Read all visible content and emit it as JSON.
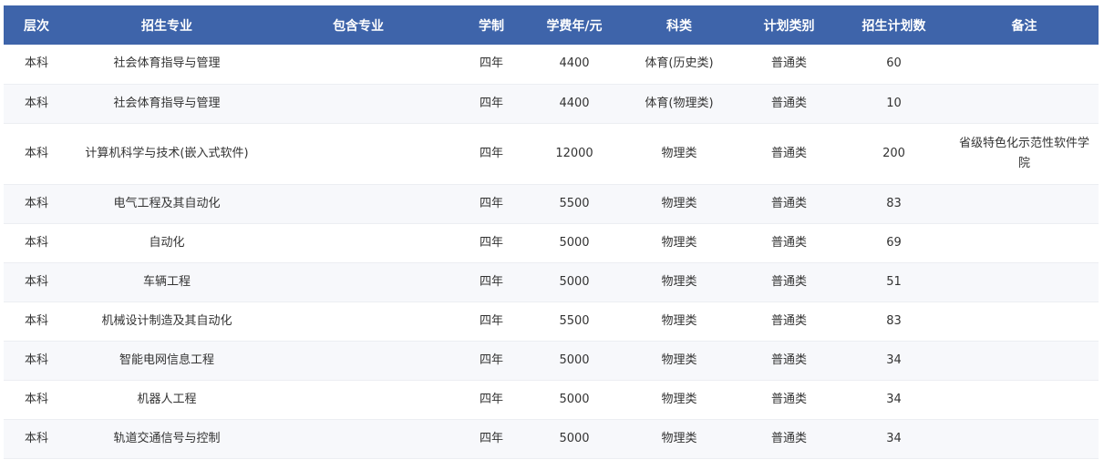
{
  "table": {
    "headers": [
      "层次",
      "招生专业",
      "包含专业",
      "学制",
      "学费年/元",
      "科类",
      "计划类别",
      "招生计划数",
      "备注"
    ],
    "rows": [
      {
        "level": "本科",
        "major": "社会体育指导与管理",
        "included": "",
        "duration": "四年",
        "fee": "4400",
        "category": "体育(历史类)",
        "plan_type": "普通类",
        "plan_count": "60",
        "note": ""
      },
      {
        "level": "本科",
        "major": "社会体育指导与管理",
        "included": "",
        "duration": "四年",
        "fee": "4400",
        "category": "体育(物理类)",
        "plan_type": "普通类",
        "plan_count": "10",
        "note": ""
      },
      {
        "level": "本科",
        "major": "计算机科学与技术(嵌入式软件)",
        "included": "",
        "duration": "四年",
        "fee": "12000",
        "category": "物理类",
        "plan_type": "普通类",
        "plan_count": "200",
        "note": "省级特色化示范性软件学院"
      },
      {
        "level": "本科",
        "major": "电气工程及其自动化",
        "included": "",
        "duration": "四年",
        "fee": "5500",
        "category": "物理类",
        "plan_type": "普通类",
        "plan_count": "83",
        "note": ""
      },
      {
        "level": "本科",
        "major": "自动化",
        "included": "",
        "duration": "四年",
        "fee": "5000",
        "category": "物理类",
        "plan_type": "普通类",
        "plan_count": "69",
        "note": ""
      },
      {
        "level": "本科",
        "major": "车辆工程",
        "included": "",
        "duration": "四年",
        "fee": "5000",
        "category": "物理类",
        "plan_type": "普通类",
        "plan_count": "51",
        "note": ""
      },
      {
        "level": "本科",
        "major": "机械设计制造及其自动化",
        "included": "",
        "duration": "四年",
        "fee": "5500",
        "category": "物理类",
        "plan_type": "普通类",
        "plan_count": "83",
        "note": ""
      },
      {
        "level": "本科",
        "major": "智能电网信息工程",
        "included": "",
        "duration": "四年",
        "fee": "5000",
        "category": "物理类",
        "plan_type": "普通类",
        "plan_count": "34",
        "note": ""
      },
      {
        "level": "本科",
        "major": "机器人工程",
        "included": "",
        "duration": "四年",
        "fee": "5000",
        "category": "物理类",
        "plan_type": "普通类",
        "plan_count": "34",
        "note": ""
      },
      {
        "level": "本科",
        "major": "轨道交通信号与控制",
        "included": "",
        "duration": "四年",
        "fee": "5000",
        "category": "物理类",
        "plan_type": "普通类",
        "plan_count": "34",
        "note": ""
      }
    ]
  }
}
